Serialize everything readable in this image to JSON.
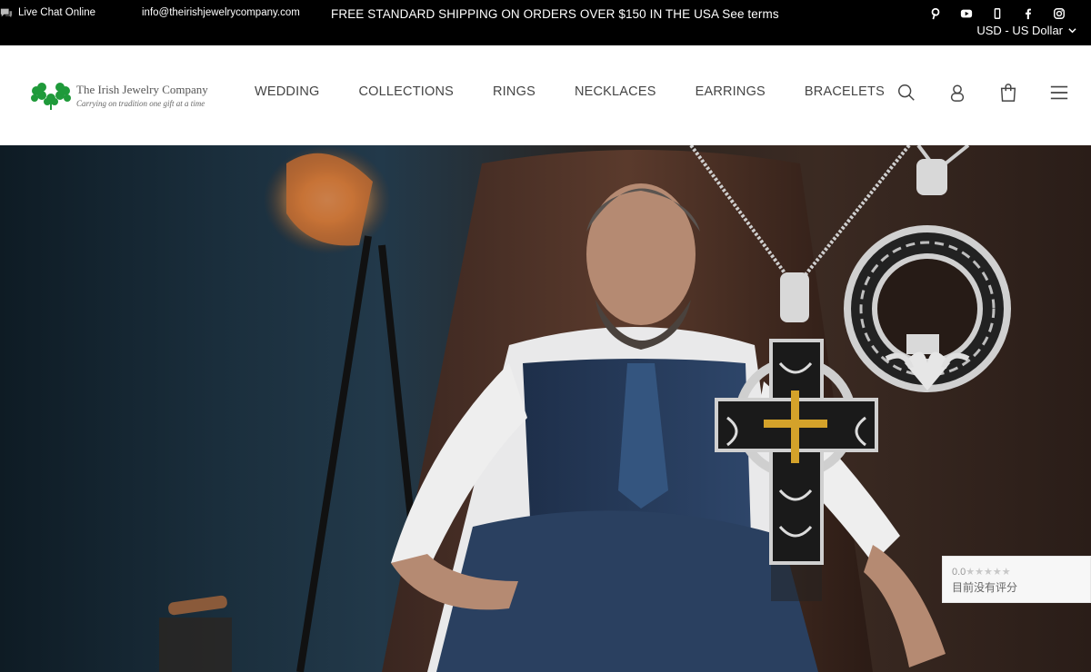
{
  "topbar": {
    "chat_label": "Live Chat Online",
    "email": "info@theirishjewelrycompany.com",
    "promo": "FREE STANDARD SHIPPING ON ORDERS OVER $150 IN THE USA See terms",
    "social": [
      "pinterest-icon",
      "youtube-icon",
      "mobile-icon",
      "facebook-icon",
      "instagram-icon"
    ],
    "currency": "USD - US Dollar"
  },
  "logo": {
    "name": "The Irish Jewelry Company",
    "tagline": "Carrying on tradition one gift at a time"
  },
  "nav": {
    "items": [
      "WEDDING",
      "COLLECTIONS",
      "RINGS",
      "NECKLACES",
      "EARRINGS",
      "BRACELETS"
    ]
  },
  "header_icons": [
    "search-icon",
    "account-icon",
    "cart-icon",
    "menu-icon"
  ],
  "review_badge": {
    "rating": "0.0",
    "stars": "★★★★★",
    "note": "目前没有评分"
  },
  "colors": {
    "topbar_bg": "#000000",
    "brand_green": "#1f9a3a",
    "nav_text": "#444444"
  }
}
